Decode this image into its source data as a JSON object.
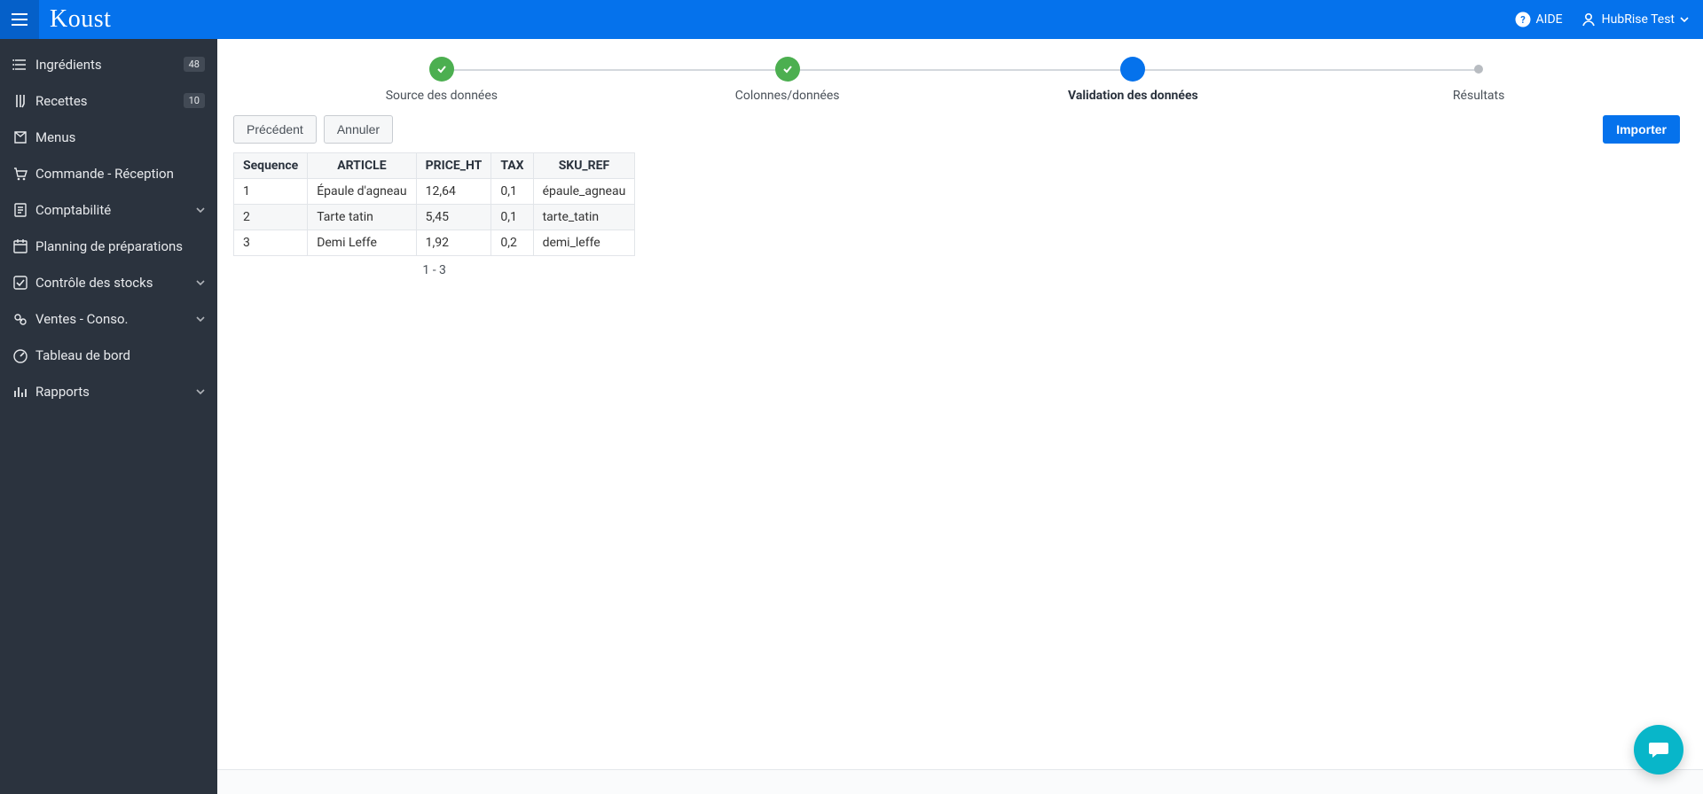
{
  "topbar": {
    "logo": "Koust",
    "help_label": "AIDE",
    "user_label": "HubRise Test"
  },
  "sidebar": {
    "items": [
      {
        "label": "Ingrédients",
        "badge": "48",
        "expandable": false
      },
      {
        "label": "Recettes",
        "badge": "10",
        "expandable": false
      },
      {
        "label": "Menus",
        "badge": null,
        "expandable": false
      },
      {
        "label": "Commande - Réception",
        "badge": null,
        "expandable": false
      },
      {
        "label": "Comptabilité",
        "badge": null,
        "expandable": true
      },
      {
        "label": "Planning de préparations",
        "badge": null,
        "expandable": false
      },
      {
        "label": "Contrôle des stocks",
        "badge": null,
        "expandable": true
      },
      {
        "label": "Ventes - Conso.",
        "badge": null,
        "expandable": true
      },
      {
        "label": "Tableau de bord",
        "badge": null,
        "expandable": false
      },
      {
        "label": "Rapports",
        "badge": null,
        "expandable": true
      }
    ]
  },
  "wizard": {
    "steps": [
      {
        "label": "Source des données",
        "state": "done"
      },
      {
        "label": "Colonnes/données",
        "state": "done"
      },
      {
        "label": "Validation des données",
        "state": "current"
      },
      {
        "label": "Résultats",
        "state": "pending"
      }
    ]
  },
  "toolbar": {
    "prev_label": "Précédent",
    "cancel_label": "Annuler",
    "import_label": "Importer"
  },
  "table": {
    "headers": [
      "Sequence",
      "ARTICLE",
      "PRICE_HT",
      "TAX",
      "SKU_REF"
    ],
    "rows": [
      [
        "1",
        "Épaule d'agneau",
        "12,64",
        "0,1",
        "épaule_agneau"
      ],
      [
        "2",
        "Tarte tatin",
        "5,45",
        "0,1",
        "tarte_tatin"
      ],
      [
        "3",
        "Demi Leffe",
        "1,92",
        "0,2",
        "demi_leffe"
      ]
    ],
    "footer": "1 - 3"
  },
  "icons": {
    "sidebar": [
      "ingredients-icon",
      "recipes-icon",
      "menus-icon",
      "order-reception-icon",
      "accounting-icon",
      "planning-icon",
      "stock-control-icon",
      "sales-icon",
      "dashboard-icon",
      "reports-icon"
    ]
  }
}
